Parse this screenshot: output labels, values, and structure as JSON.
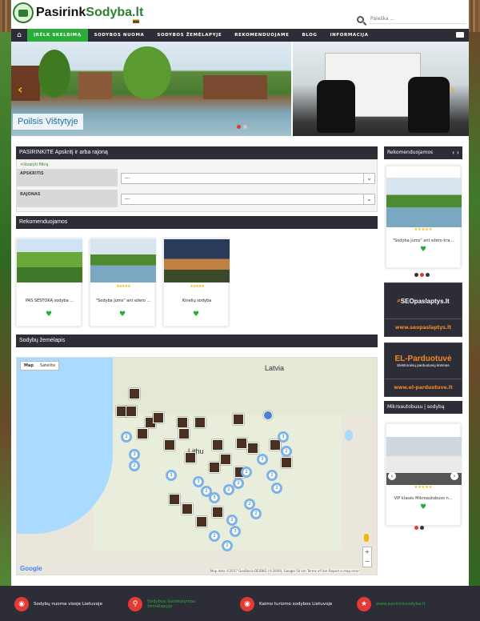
{
  "header": {
    "logo_pre": "Pasirink",
    "logo_post": "Sodyba.lt",
    "search_placeholder": "Paieška ..."
  },
  "nav": {
    "items": [
      "įrėlk skelbimą",
      "Sodybos nuoma",
      "Sodybos žemėlapyje",
      "Rekomenduojame",
      "Blog",
      "Informacija"
    ]
  },
  "slider": {
    "caption": "Poilsis Vištytyje"
  },
  "filter": {
    "title": "PASIRINKITE Apskritį ir arba rajoną",
    "reset": "Išvalyti filtrą",
    "county_label": "APSKRITIS",
    "county_value": "---",
    "district_label": "RAJONAS",
    "district_value": "---"
  },
  "reco": {
    "title": "Rekomenduojamos",
    "cards": [
      {
        "title": "PAS ŠEŠTOKĄ sodyba ..."
      },
      {
        "title": "\"Sodyba Jums\" ant ežero ..."
      },
      {
        "title": "Kinelių sodyba"
      }
    ]
  },
  "map": {
    "title": "Sodybų žemėlapis",
    "type_map": "Map",
    "type_sat": "Satelite",
    "country_latvia": "Latvia",
    "country_lithuania": "Lithu",
    "google": "Google",
    "attrib": "Map data ©2017 GeoBasis-DE/BKG (©2009), Google  50 km  Terms of Use  Report a map error",
    "zoom_in": "+",
    "zoom_out": "−",
    "clusters": [
      "2",
      "3",
      "2",
      "3",
      "3",
      "2",
      "3",
      "2",
      "2",
      "2",
      "3",
      "2",
      "2",
      "2",
      "3",
      "2",
      "2",
      "2",
      "3",
      "2",
      "2"
    ]
  },
  "sidebar": {
    "reco_title": "Rekomenduojamos",
    "reco_card": "\"Sodyba Jums\" ant ežero kra...",
    "ad1_brand": "SEOpaslaptys.lt",
    "ad1_url": "www.seopaslaptys.lt",
    "ad2_brand": "EL-Parduotuvė",
    "ad2_sub": "Elektroninių parduotuvių kūrimas",
    "ad2_url": "www.el-parduotuve.lt",
    "bus_title": "Mikroautobusu į sodybą",
    "bus_card": "VIP klasės Mikroautobuso n..."
  },
  "footer": {
    "items": [
      "Sodybų nuoma visoje Lietuvoje",
      "Sodybos išsidėstymas žemėlapyje",
      "Kaimo turizmo sodybos Lietuvoje",
      "www.pasirinksodyba.lt"
    ]
  }
}
